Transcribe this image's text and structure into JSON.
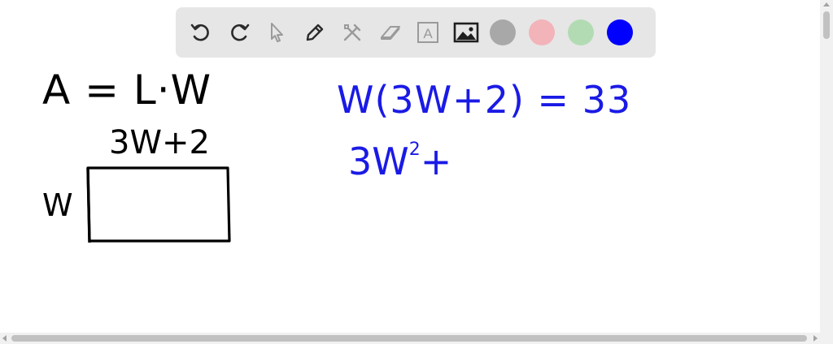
{
  "toolbar": {
    "tools": [
      {
        "name": "undo-icon",
        "enabled": true
      },
      {
        "name": "redo-icon",
        "enabled": true
      },
      {
        "name": "pointer-icon",
        "enabled": false
      },
      {
        "name": "pen-icon",
        "enabled": true
      },
      {
        "name": "tools-icon",
        "enabled": false
      },
      {
        "name": "eraser-icon",
        "enabled": false
      },
      {
        "name": "text-icon",
        "enabled": false
      },
      {
        "name": "image-icon",
        "enabled": true
      }
    ],
    "text_tool_label": "A",
    "colors": [
      "#a8a8a8",
      "#f2b3b9",
      "#b3dbb3",
      "#0000ff"
    ]
  },
  "whiteboard": {
    "ink_black": "#000000",
    "ink_blue": "#1a1ae6",
    "formula_area": "A = L·W",
    "length_label": "3W+2",
    "width_label": "W",
    "equation_1": "W(3W+2) = 33",
    "equation_2_base": "3W",
    "equation_2_exp": "2",
    "equation_2_rest": "+"
  }
}
